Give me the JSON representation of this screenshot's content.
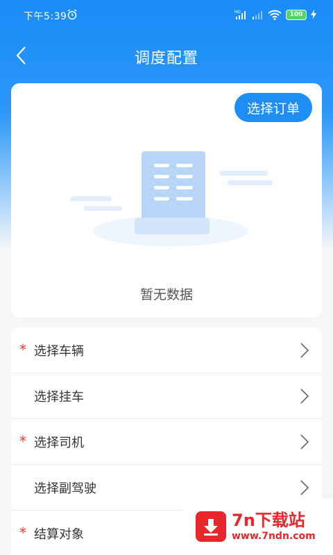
{
  "status_bar": {
    "time": "下午5:39",
    "battery": "100"
  },
  "header": {
    "title": "调度配置",
    "back_icon": "chevron-left-icon"
  },
  "order": {
    "button_label": "选择订单",
    "empty_text": "暂无数据"
  },
  "form_rows": [
    {
      "label": "选择车辆",
      "required": true
    },
    {
      "label": "选择挂车",
      "required": false
    },
    {
      "label": "选择司机",
      "required": true
    },
    {
      "label": "选择副驾驶",
      "required": false
    },
    {
      "label": "结算对象",
      "required": true
    }
  ],
  "required_mark": "*",
  "watermark": {
    "title": "7n下载站",
    "url": "www.7ndn.com"
  },
  "colors": {
    "primary": "#1e8ef6",
    "required": "#e53935"
  }
}
